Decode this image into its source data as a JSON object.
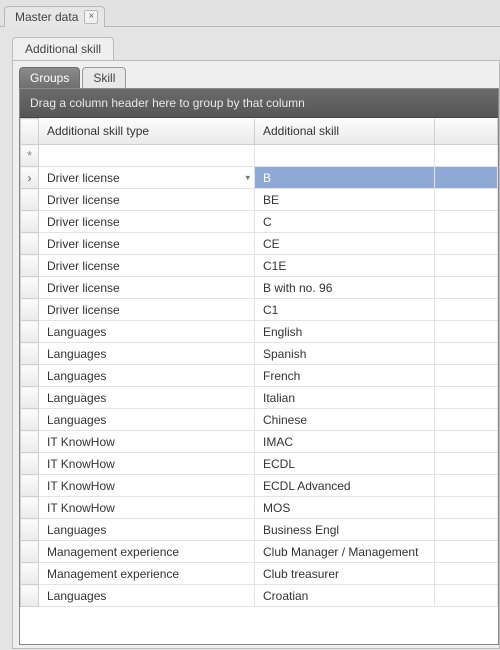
{
  "docTab": {
    "label": "Master data"
  },
  "sectionTab": {
    "label": "Additional skill"
  },
  "innerTabs": {
    "groups": "Groups",
    "skill": "Skill"
  },
  "groupPanel": "Drag a column header here to group by that column",
  "columns": {
    "type": "Additional skill type",
    "skill": "Additional skill"
  },
  "newRowIndicator": "*",
  "selectedIndicator": "›",
  "selectedIndex": 0,
  "rows": [
    {
      "type": "Driver license",
      "skill": "B"
    },
    {
      "type": "Driver license",
      "skill": "BE"
    },
    {
      "type": "Driver license",
      "skill": "C"
    },
    {
      "type": "Driver license",
      "skill": "CE"
    },
    {
      "type": "Driver license",
      "skill": "C1E"
    },
    {
      "type": "Driver license",
      "skill": "B with no. 96"
    },
    {
      "type": "Driver license",
      "skill": "C1"
    },
    {
      "type": "Languages",
      "skill": "English"
    },
    {
      "type": "Languages",
      "skill": "Spanish"
    },
    {
      "type": "Languages",
      "skill": "French"
    },
    {
      "type": "Languages",
      "skill": "Italian"
    },
    {
      "type": "Languages",
      "skill": "Chinese"
    },
    {
      "type": "IT KnowHow",
      "skill": "IMAC"
    },
    {
      "type": "IT KnowHow",
      "skill": "ECDL"
    },
    {
      "type": "IT KnowHow",
      "skill": "ECDL Advanced"
    },
    {
      "type": "IT KnowHow",
      "skill": "MOS"
    },
    {
      "type": "Languages",
      "skill": "Business Engl"
    },
    {
      "type": "Management experience",
      "skill": "Club Manager / Management"
    },
    {
      "type": "Management experience",
      "skill": "Club treasurer"
    },
    {
      "type": "Languages",
      "skill": "Croatian"
    }
  ]
}
